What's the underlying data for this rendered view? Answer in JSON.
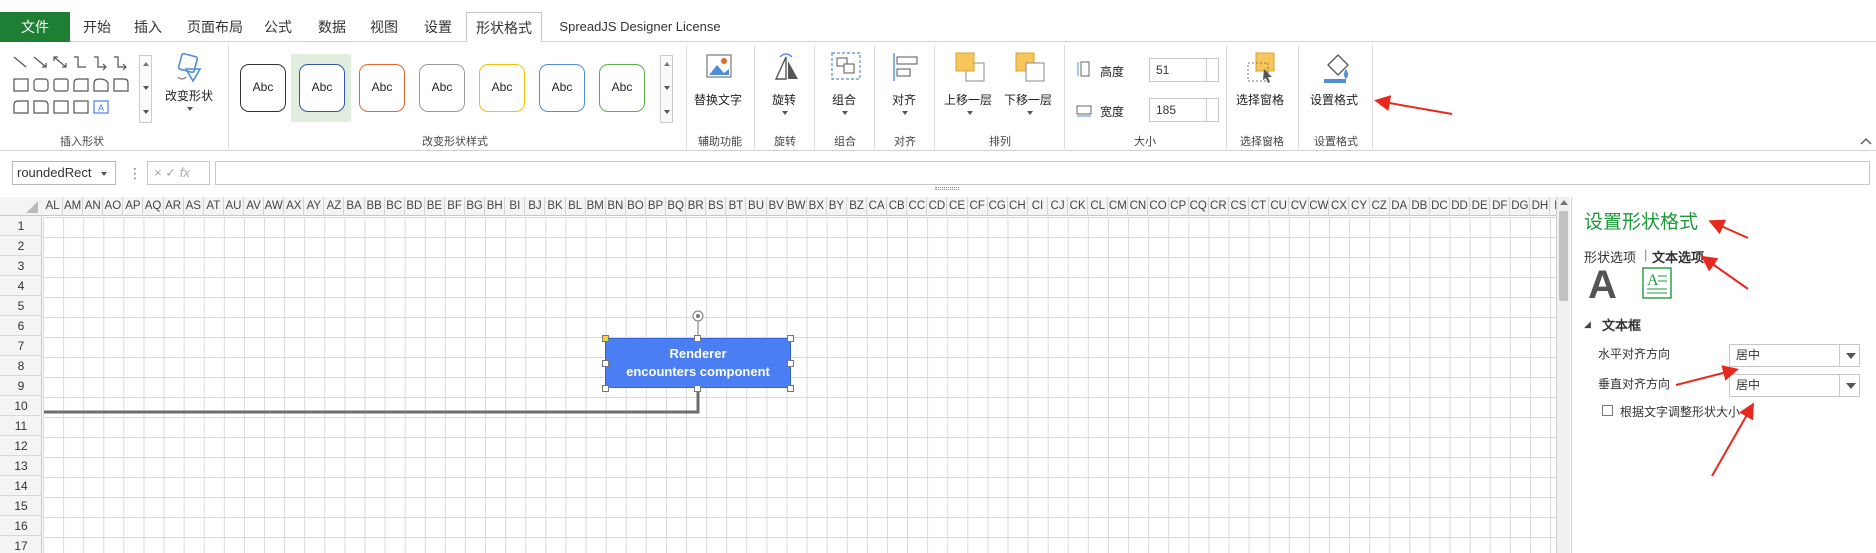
{
  "tabs": [
    {
      "label": "文件"
    },
    {
      "label": "开始"
    },
    {
      "label": "插入"
    },
    {
      "label": "页面布局"
    },
    {
      "label": "公式"
    },
    {
      "label": "数据"
    },
    {
      "label": "视图"
    },
    {
      "label": "设置"
    },
    {
      "label": "形状格式"
    },
    {
      "label": "SpreadJS Designer License"
    }
  ],
  "ribbon": {
    "change_shape": "改变形状",
    "insert_shapes_group": "插入形状",
    "shape_styles_group": "改变形状样式",
    "style_swatches": [
      {
        "text": "Abc",
        "color": "#222222"
      },
      {
        "text": "Abc",
        "color": "#3355aa"
      },
      {
        "text": "Abc",
        "color": "#e06a2a"
      },
      {
        "text": "Abc",
        "color": "#9a9a9a"
      },
      {
        "text": "Abc",
        "color": "#f0c20a"
      },
      {
        "text": "Abc",
        "color": "#4f8fd8"
      },
      {
        "text": "Abc",
        "color": "#5fae4a"
      }
    ],
    "alt_text": "替换文字",
    "accessibility_group": "辅助功能",
    "rotate": "旋转",
    "rotate_group": "旋转",
    "group": "组合",
    "group_group": "组合",
    "align": "对齐",
    "align_group": "对齐",
    "bring_forward": "上移一层",
    "send_backward": "下移一层",
    "arrange_group": "排列",
    "height_label": "高度",
    "height_value": "51",
    "width_label": "宽度",
    "width_value": "185",
    "size_group": "大小",
    "selection_pane": "选择窗格",
    "selection_pane_group": "选择窗格",
    "format_shape": "设置格式",
    "format_shape_group": "设置格式"
  },
  "formula_bar": {
    "name_box": "roundedRect",
    "fx_symbols": "× ✓ fx",
    "value": ""
  },
  "sheet": {
    "columns": [
      "AL",
      "AM",
      "AN",
      "AO",
      "AP",
      "AQ",
      "AR",
      "AS",
      "AT",
      "AU",
      "AV",
      "AW",
      "AX",
      "AY",
      "AZ",
      "BA",
      "BB",
      "BC",
      "BD",
      "BE",
      "BF",
      "BG",
      "BH",
      "BI",
      "BJ",
      "BK",
      "BL",
      "BM",
      "BN",
      "BO",
      "BP",
      "BQ",
      "BR",
      "BS",
      "BT",
      "BU",
      "BV",
      "BW",
      "BX",
      "BY",
      "BZ",
      "CA",
      "CB",
      "CC",
      "CD",
      "CE",
      "CF",
      "CG",
      "CH",
      "CI",
      "CJ",
      "CK",
      "CL",
      "CM",
      "CN",
      "CO",
      "CP",
      "CQ",
      "CR",
      "CS",
      "CT",
      "CU",
      "CV",
      "CW",
      "CX",
      "CY",
      "CZ",
      "DA",
      "DB",
      "DC",
      "DD",
      "DE",
      "DF",
      "DG",
      "DH",
      "DI"
    ],
    "rows": [
      "1",
      "2",
      "3",
      "4",
      "5",
      "6",
      "7",
      "8",
      "9",
      "10",
      "11",
      "12",
      "13",
      "14",
      "15",
      "16",
      "17"
    ],
    "shape_text_line1": "Renderer",
    "shape_text_line2": "encounters component",
    "shape_color": "#4a7ef2"
  },
  "panel": {
    "title": "设置形状格式",
    "tab_shape_options": "形状选项",
    "tab_divider": "|",
    "tab_text_options": "文本选项",
    "section_textbox": "文本框",
    "h_align_label": "水平对齐方向",
    "h_align_value": "居中",
    "v_align_label": "垂直对齐方向",
    "v_align_value": "居中",
    "autofit_label": "根据文字调整形状大小",
    "accent_color": "#1e9a3a"
  }
}
